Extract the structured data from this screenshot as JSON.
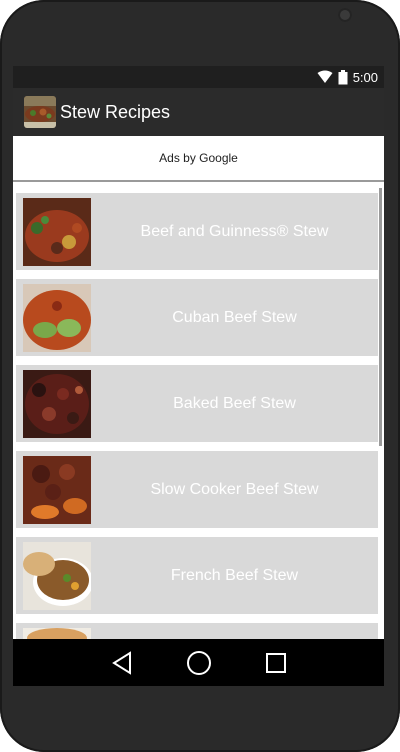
{
  "status": {
    "time": "5:00",
    "icons": [
      "wifi-icon",
      "battery-icon"
    ]
  },
  "app": {
    "title": "Stew Recipes",
    "icon": "stew-icon"
  },
  "ads": {
    "label": "Ads by Google"
  },
  "recipes": [
    {
      "title": "Beef and Guinness® Stew",
      "thumb": "beef-guinness-photo"
    },
    {
      "title": "Cuban Beef Stew",
      "thumb": "cuban-stew-photo"
    },
    {
      "title": "Baked Beef Stew",
      "thumb": "baked-stew-photo"
    },
    {
      "title": "Slow Cooker Beef Stew",
      "thumb": "slow-cooker-photo"
    },
    {
      "title": "French Beef Stew",
      "thumb": "french-stew-photo"
    },
    {
      "title": "",
      "thumb": "stew-photo"
    }
  ],
  "nav": {
    "back": "back-icon",
    "home": "home-icon",
    "recents": "recents-icon"
  },
  "colors": {
    "statusbar": "#1f1f1f",
    "actionbar": "#2b2b2b",
    "list_item": "#d9d9d9",
    "navbar": "#000000"
  }
}
